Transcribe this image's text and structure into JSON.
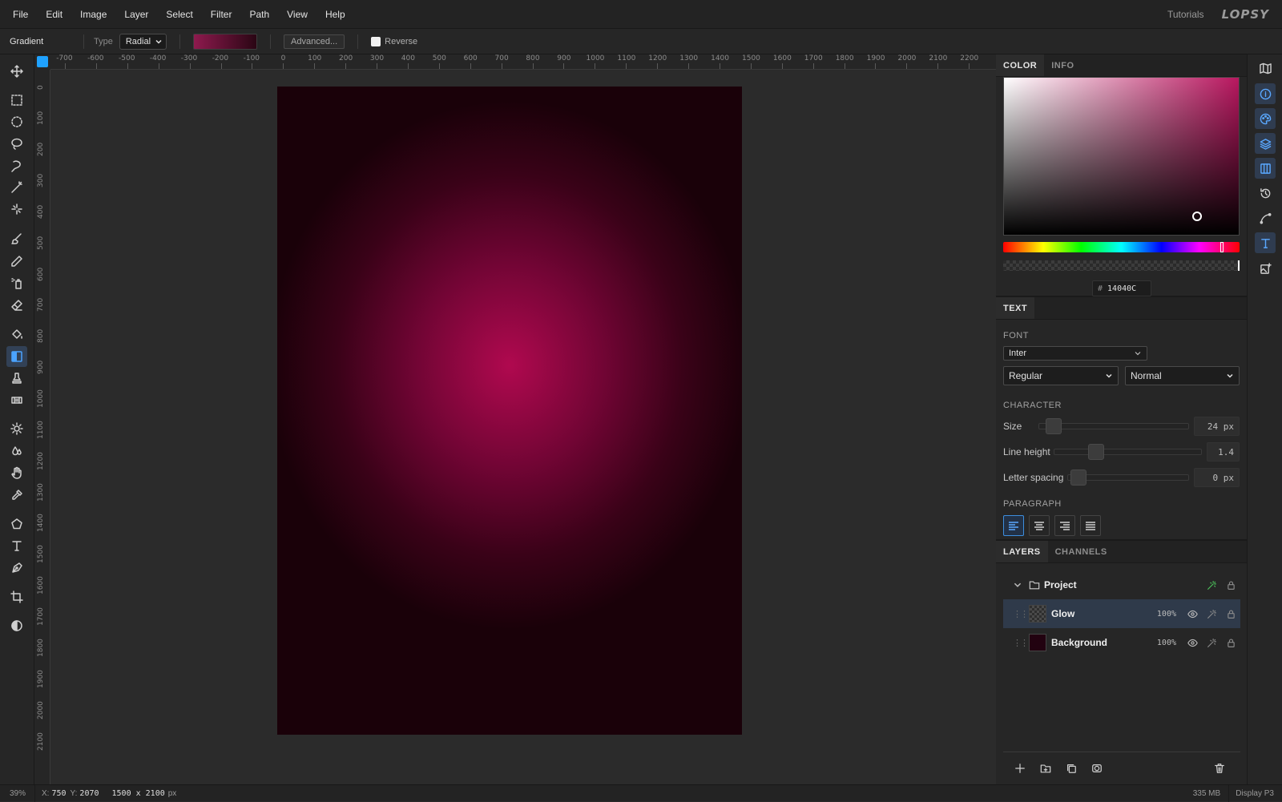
{
  "menu": {
    "items": [
      "File",
      "Edit",
      "Image",
      "Layer",
      "Select",
      "Filter",
      "Path",
      "View",
      "Help"
    ],
    "tutorials": "Tutorials",
    "logo": "LOPSY"
  },
  "options": {
    "tool_name": "Gradient",
    "type_label": "Type",
    "type_value": "Radial",
    "advanced_label": "Advanced...",
    "reverse_label": "Reverse",
    "gradient_colors": [
      "#8e1a4e",
      "#2a0614"
    ]
  },
  "ruler_h": [
    "-700",
    "-600",
    "-500",
    "-400",
    "-300",
    "-200",
    "-100",
    "0",
    "100",
    "200",
    "300",
    "400",
    "500",
    "600",
    "700",
    "800",
    "900",
    "1000",
    "1100",
    "1200",
    "1300",
    "1400",
    "1500",
    "1600",
    "1700",
    "1800",
    "1900",
    "2000",
    "2100",
    "2200"
  ],
  "ruler_v": [
    "0",
    "100",
    "200",
    "300",
    "400",
    "500",
    "600",
    "700",
    "800",
    "900",
    "1000",
    "1100",
    "1200",
    "1300",
    "1400",
    "1500",
    "1600",
    "1700",
    "1800",
    "1900",
    "2000",
    "2100"
  ],
  "color_panel": {
    "tabs": [
      "COLOR",
      "INFO"
    ],
    "hex_label": "#",
    "hex_value": "14040C",
    "hue_color": "#b8175f"
  },
  "text_panel": {
    "tab": "TEXT",
    "font_label": "FONT",
    "font_value": "Inter",
    "weight_value": "Regular",
    "style_value": "Normal",
    "character_label": "CHARACTER",
    "size_label": "Size",
    "size_value": "24 px",
    "line_height_label": "Line height",
    "line_height_value": "1.4",
    "letter_spacing_label": "Letter spacing",
    "letter_spacing_value": "0 px",
    "paragraph_label": "PARAGRAPH"
  },
  "layers_panel": {
    "tabs": [
      "LAYERS",
      "CHANNELS"
    ],
    "group": {
      "name": "Project"
    },
    "layers": [
      {
        "name": "Glow",
        "opacity": "100%"
      },
      {
        "name": "Background",
        "opacity": "100%"
      }
    ]
  },
  "status": {
    "zoom": "39%",
    "x_label": "X:",
    "x_value": "750",
    "y_label": "Y:",
    "y_value": "2070",
    "size": "1500 x 2100",
    "size_unit": "px",
    "memory": "335 MB",
    "display": "Display P3"
  },
  "colors": {
    "accent": "#1fa2ff",
    "active_tool_bg": "#324156",
    "doc_center": "#b0094f",
    "doc_edge": "#1a0109"
  }
}
